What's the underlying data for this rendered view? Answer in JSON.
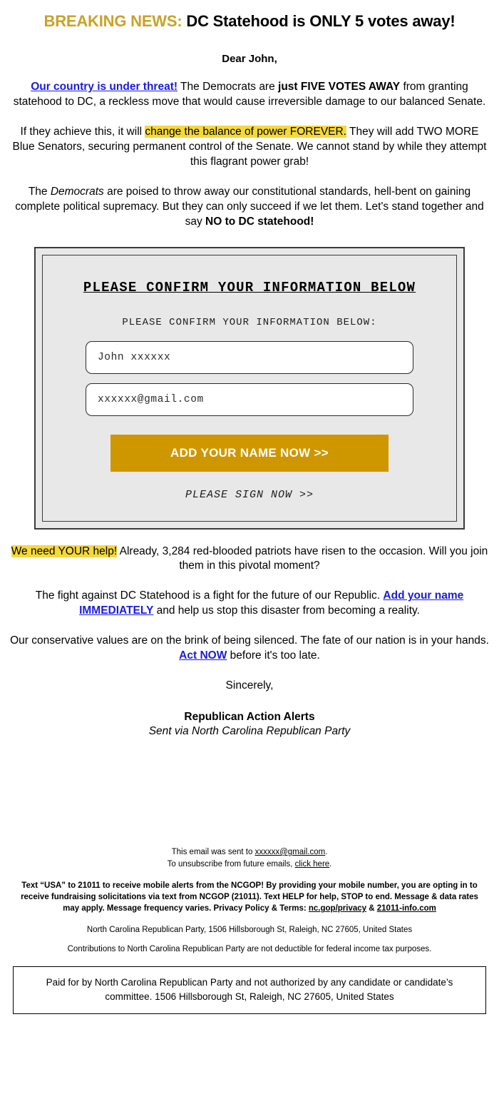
{
  "headline": {
    "prefix": "BREAKING NEWS:",
    "rest": " DC Statehood is ONLY 5 votes away!"
  },
  "salutation": "Dear John,",
  "paragraphs": {
    "p1": {
      "link": "Our country is under threat!",
      "t1": " The Democrats are ",
      "b1": "just FIVE VOTES AWAY",
      "t2": " from granting statehood to DC, a reckless move that would cause irreversible damage to our balanced Senate."
    },
    "p2": {
      "t1": "If they achieve this, it will ",
      "hl": "change the balance of power FOREVER.",
      "t2": " They will add TWO MORE Blue Senators, securing permanent control of the Senate. We cannot stand by while they attempt this flagrant power grab!"
    },
    "p3": {
      "t1": "The ",
      "i1": "Democrats",
      "t2": " are poised to throw away our constitutional standards, hell-bent on gaining complete political supremacy. But they can only succeed if we let them. Let's stand together and say ",
      "b1": "NO to DC statehood!"
    },
    "p4": {
      "hl": "We need YOUR help!",
      "t1": " Already, 3,284 red-blooded patriots have risen to the occasion. Will you join them in this pivotal moment?"
    },
    "p5": {
      "t1": "The fight against DC Statehood is a fight for the future of our Republic. ",
      "link": "Add your name IMMEDIATELY",
      "t2": " and help us stop this disaster from becoming a reality."
    },
    "p6": {
      "t1": "Our conservative values are on the brink of being silenced. The fate of our nation is in your hands. ",
      "link": "Act NOW",
      "t2": " before it's too late."
    }
  },
  "form": {
    "title": "PLEASE CONFIRM YOUR INFORMATION BELOW",
    "subtitle": "PLEASE CONFIRM YOUR INFORMATION BELOW:",
    "name_value": "John xxxxxx",
    "name_placeholder": "John xxxxxx",
    "email_value": "xxxxxx@gmail.com",
    "email_placeholder": "xxxxxx@gmail.com",
    "cta_label": "ADD YOUR NAME NOW >>",
    "sign_now": "PLEASE SIGN NOW >>"
  },
  "closing": {
    "sincerely": "Sincerely,",
    "name": "Republican Action Alerts",
    "org": "Sent via North Carolina Republican Party"
  },
  "footer": {
    "sent_to_prefix": "This email was sent to ",
    "sent_to_email": "xxxxxx@gmail.com",
    "sent_to_suffix": ".",
    "unsub_prefix": "To unsubscribe from future emails, ",
    "unsub_link": "click here",
    "unsub_suffix": ".",
    "sms_text": "Text “USA” to 21011 to receive mobile alerts from the NCGOP! By providing your mobile number, you are opting in to receive fundraising solicitations via text from NCGOP (21011). Text HELP for help, STOP to end. Message & data rates may apply. Message frequency varies. Privacy Policy & Terms: ",
    "sms_link1": "nc.gop/privacy",
    "sms_amp": " & ",
    "sms_link2": "21011-info.com",
    "address": "North Carolina Republican Party, 1506 Hillsborough St, Raleigh, NC 27605, United States",
    "contributions": "Contributions to North Carolina Republican Party are not deductible for federal income tax purposes.",
    "paid_for": "Paid for by North Carolina Republican Party and not authorized by any candidate or candidate’s committee. 1506 Hillsborough St, Raleigh, NC 27605, United States"
  },
  "colors": {
    "gold_headline": "#c9a227",
    "gold_button": "#ce9700",
    "highlight_yellow": "#f5d93c",
    "link_blue": "#1a1ae0",
    "box_fill": "#e8e8e8",
    "box_border": "#3a3a3a"
  }
}
